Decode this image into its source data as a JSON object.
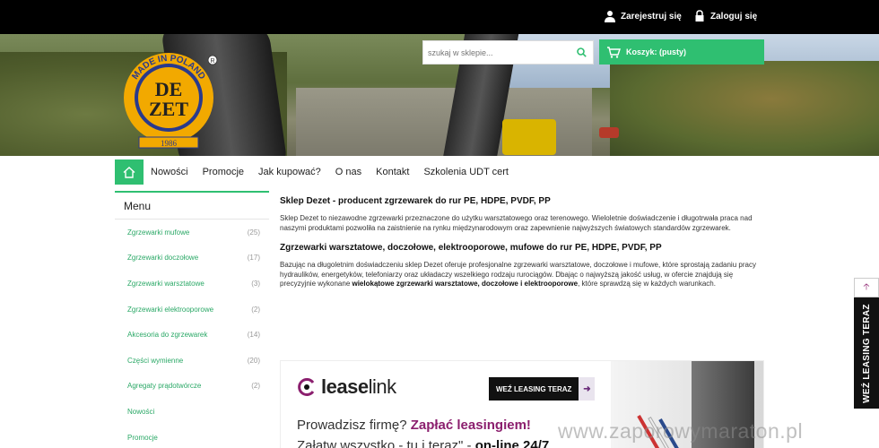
{
  "topbar": {
    "register_label": "Zarejestruj się",
    "login_label": "Zaloguj się"
  },
  "logo": {
    "top_text": "MADE IN POLAND",
    "line1": "DE",
    "line2": "ZET",
    "year": "1986",
    "reg": "R"
  },
  "search": {
    "placeholder": "szukaj w sklepie..."
  },
  "cart": {
    "label": "Koszyk: (pusty)"
  },
  "nav": {
    "items": [
      "Nowości",
      "Promocje",
      "Jak kupować?",
      "O nas",
      "Kontakt",
      "Szkolenia UDT cert"
    ]
  },
  "sidebar": {
    "title": "Menu",
    "items": [
      {
        "label": "Zgrzewarki mufowe",
        "count": "(25)"
      },
      {
        "label": "Zgrzewarki doczołowe",
        "count": "(17)"
      },
      {
        "label": "Zgrzewarki warsztatowe",
        "count": "(3)"
      },
      {
        "label": "Zgrzewarki elektrooporowe",
        "count": "(2)"
      },
      {
        "label": "Akcesoria do zgrzewarek",
        "count": "(14)"
      },
      {
        "label": "Części wymienne",
        "count": "(20)"
      },
      {
        "label": "Agregaty prądotwórcze",
        "count": "(2)"
      },
      {
        "label": "Nowości",
        "count": ""
      },
      {
        "label": "Promocje",
        "count": ""
      }
    ]
  },
  "content": {
    "heading1": "Sklep Dezet - producent zgrzewarek do rur PE, HDPE, PVDF, PP",
    "para1": "Sklep Dezet to niezawodne zgrzewarki przeznaczone do użytku warsztatowego oraz terenowego. Wieloletnie doświadczenie i długotrwała praca nad naszymi produktami pozwoliła na zaistnienie na rynku międzynarodowym oraz zapewnienie najwyższych światowych standardów zgrzewarek.",
    "heading2": "Zgrzewarki warsztatowe, doczołowe, elektrooporowe, mufowe do rur PE, HDPE, PVDF, PP",
    "para2_start": "Bazując na długoletnim doświadczeniu sklep Dezet oferuje profesjonalne zgrzewarki warsztatowe, doczołowe i mufowe, które sprostają zadaniu pracy hydraulików, energetyków, telefoniarzy oraz układaczy wszelkiego rodzaju rurociągów. Dbając o najwyższą jakość usług, w ofercie znajdują się precyzyjnie wykonane ",
    "para2_bold": "wielokątowe zgrzewarki warsztatowe, doczołowe i elektrooporowe",
    "para2_end": ", które sprawdzą się w każdych warunkach."
  },
  "banner": {
    "brand_bold": "lease",
    "brand_light": "link",
    "button_label": "WEŹ LEASING TERAZ",
    "line1_start": "Prowadzisz firmę? ",
    "line1_bold": "Zapłać leasingiem!",
    "line2_start": "Załatw wszystko - tu i teraz\" - ",
    "line2_bold": "on-line 24/7"
  },
  "sidetab": {
    "label": "WEŹ LEASING TERAZ"
  },
  "watermark": "www.zaporowymaraton.pl",
  "colors": {
    "accent": "#2fbf71",
    "link_green": "#2aa866",
    "leaselink_purple": "#8b1f6e",
    "topbar": "#000000",
    "logo_gold": "#f2a900",
    "logo_blue": "#2a3a8c"
  }
}
